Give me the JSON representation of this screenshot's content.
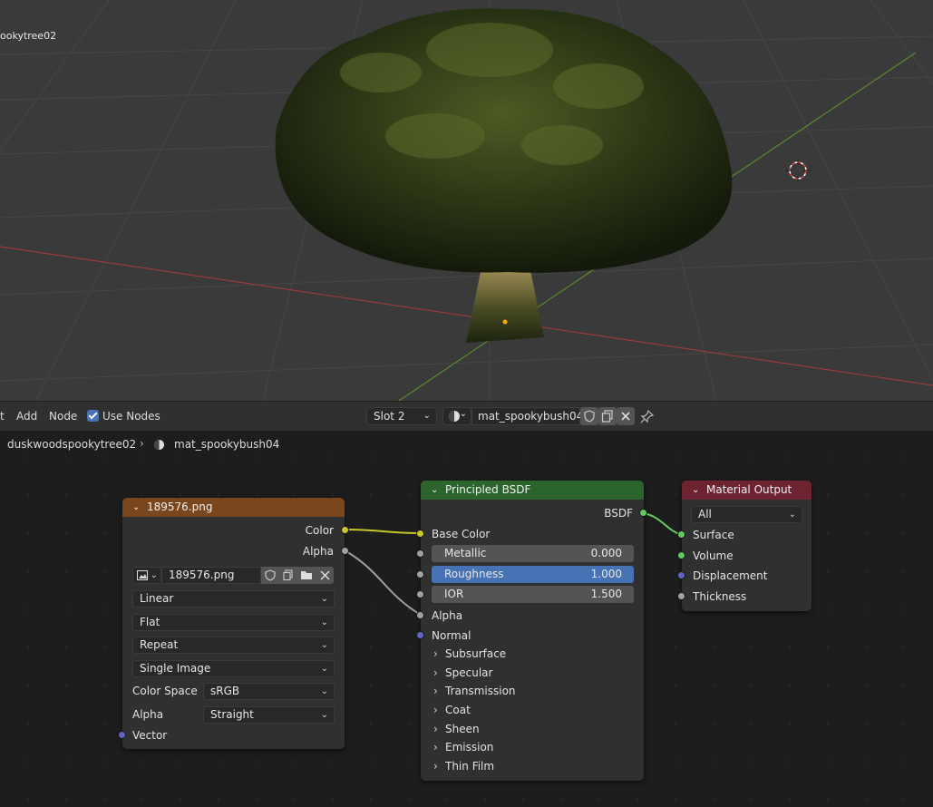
{
  "viewport": {
    "object_label": "ookytree02"
  },
  "header": {
    "menu": [
      "t",
      "Add",
      "Node"
    ],
    "use_nodes_label": "Use Nodes",
    "slot": "Slot 2",
    "material_name": "mat_spookybush04"
  },
  "breadcrumb": {
    "object": "duskwoodspookytree02",
    "material": "mat_spookybush04"
  },
  "image_node": {
    "title": "189576.png",
    "out_color": "Color",
    "out_alpha": "Alpha",
    "image_name": "189576.png",
    "interpolation": "Linear",
    "projection": "Flat",
    "extension": "Repeat",
    "source": "Single Image",
    "color_space_label": "Color Space",
    "color_space": "sRGB",
    "alpha_label": "Alpha",
    "alpha_mode": "Straight",
    "in_vector": "Vector",
    "header_color": "#79461d"
  },
  "bsdf_node": {
    "title": "Principled BSDF",
    "out_bsdf": "BSDF",
    "base_color": "Base Color",
    "metallic_label": "Metallic",
    "metallic": "0.000",
    "roughness_label": "Roughness",
    "roughness": "1.000",
    "ior_label": "IOR",
    "ior": "1.500",
    "alpha": "Alpha",
    "normal": "Normal",
    "panels": [
      "Subsurface",
      "Specular",
      "Transmission",
      "Coat",
      "Sheen",
      "Emission",
      "Thin Film"
    ],
    "header_color": "#2b652b"
  },
  "output_node": {
    "title": "Material Output",
    "target": "All",
    "surface": "Surface",
    "volume": "Volume",
    "displacement": "Displacement",
    "thickness": "Thickness",
    "header_color": "#6e2430"
  }
}
